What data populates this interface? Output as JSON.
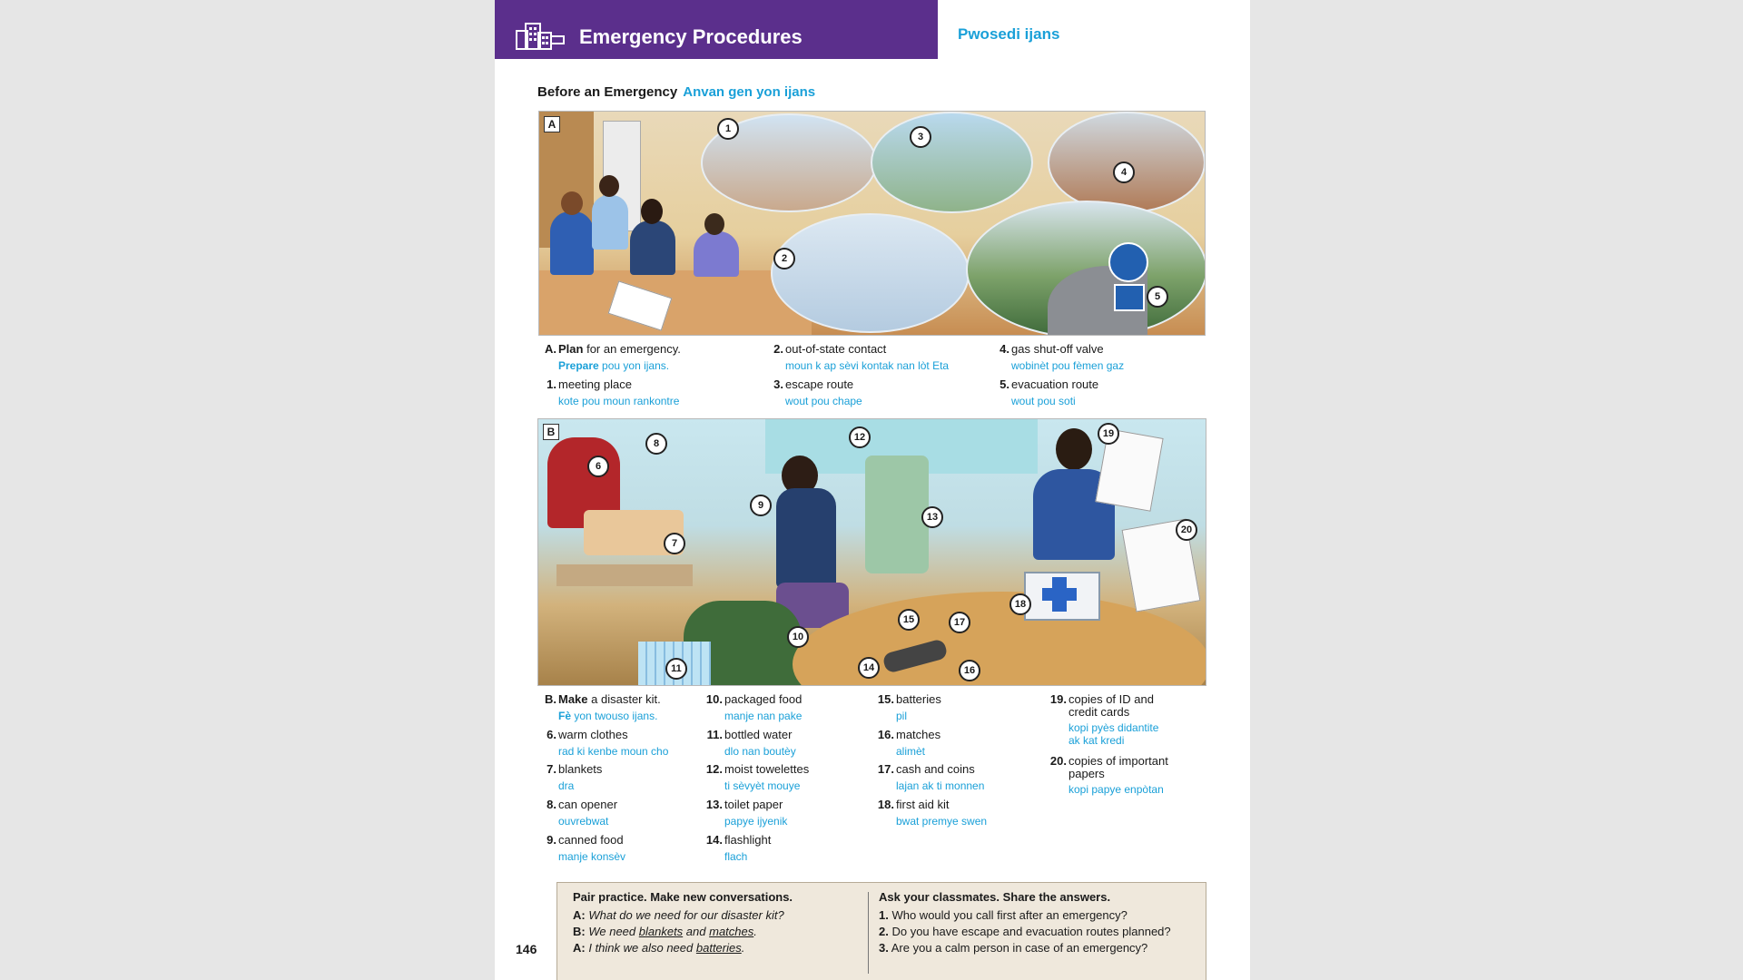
{
  "header": {
    "title": "Emergency Procedures",
    "subtitle": "Pwosedi ijans"
  },
  "section": {
    "title": "Before an Emergency",
    "translation": "Anvan gen yon ijans"
  },
  "panelA": {
    "letter": "A",
    "callouts": [
      "1",
      "2",
      "3",
      "4",
      "5"
    ],
    "vocab": [
      {
        "n": "A.",
        "en_bold": "Plan",
        "en_rest": " for an emergency.",
        "ht_bold": "Prepare",
        "ht_rest": " pou yon ijans."
      },
      {
        "n": "1.",
        "en": "meeting place",
        "ht": "kote pou moun rankontre"
      },
      {
        "n": "2.",
        "en": "out-of-state contact",
        "ht": "moun k ap sèvi kontak nan lòt Eta"
      },
      {
        "n": "3.",
        "en": "escape route",
        "ht": "wout pou chape"
      },
      {
        "n": "4.",
        "en": "gas shut-off valve",
        "ht": "wobinèt pou fèmen gaz"
      },
      {
        "n": "5.",
        "en": "evacuation route",
        "ht": "wout pou soti"
      }
    ]
  },
  "panelB": {
    "letter": "B",
    "callouts": [
      "6",
      "7",
      "8",
      "9",
      "10",
      "11",
      "12",
      "13",
      "14",
      "15",
      "16",
      "17",
      "18",
      "19",
      "20"
    ],
    "vocab": [
      {
        "n": "B.",
        "en_bold": "Make",
        "en_rest": " a disaster kit.",
        "ht_bold": "Fè",
        "ht_rest": " yon twouso ijans."
      },
      {
        "n": "6.",
        "en": "warm clothes",
        "ht": "rad ki kenbe moun cho"
      },
      {
        "n": "7.",
        "en": "blankets",
        "ht": "dra"
      },
      {
        "n": "8.",
        "en": "can opener",
        "ht": "ouvrebwat"
      },
      {
        "n": "9.",
        "en": "canned food",
        "ht": "manje konsèv"
      },
      {
        "n": "10.",
        "en": "packaged food",
        "ht": "manje nan pake"
      },
      {
        "n": "11.",
        "en": "bottled water",
        "ht": "dlo nan boutèy"
      },
      {
        "n": "12.",
        "en": "moist towelettes",
        "ht": "ti sèvyèt mouye"
      },
      {
        "n": "13.",
        "en": "toilet paper",
        "ht": "papye ijyenik"
      },
      {
        "n": "14.",
        "en": "flashlight",
        "ht": "flach"
      },
      {
        "n": "15.",
        "en": "batteries",
        "ht": "pil"
      },
      {
        "n": "16.",
        "en": "matches",
        "ht": "alimèt"
      },
      {
        "n": "17.",
        "en": "cash and coins",
        "ht": "lajan ak ti monnen"
      },
      {
        "n": "18.",
        "en": "first aid kit",
        "ht": "bwat premye swen"
      },
      {
        "n": "19.",
        "en1": "copies of ID and",
        "en2": "credit cards",
        "ht1": "kopi pyès didantite",
        "ht2": "ak kat kredi"
      },
      {
        "n": "20.",
        "en1": "copies of important",
        "en2": "papers",
        "ht": "kopi papye enpòtan"
      }
    ]
  },
  "practice": {
    "left_title": "Pair practice. Make new conversations.",
    "lines": [
      {
        "speaker": "A:",
        "text": "What do we need for our disaster kit?"
      },
      {
        "speaker": "B:",
        "pre": "We need ",
        "u1": "blankets",
        "mid": " and ",
        "u2": "matches",
        "post": "."
      },
      {
        "speaker": "A:",
        "pre": "I think we also need ",
        "u1": "batteries",
        "post": "."
      }
    ],
    "right_title": "Ask your classmates. Share the answers.",
    "questions": [
      {
        "n": "1.",
        "text": "Who would you call first after an emergency?"
      },
      {
        "n": "2.",
        "text": "Do you have escape and evacuation routes planned?"
      },
      {
        "n": "3.",
        "text": "Are you a calm person in case of an emergency?"
      }
    ]
  },
  "page_number": "146",
  "colors": {
    "header_bg": "#5b2f8c",
    "translation": "#1aa0d8",
    "practice_bg": "#efe8dc"
  }
}
